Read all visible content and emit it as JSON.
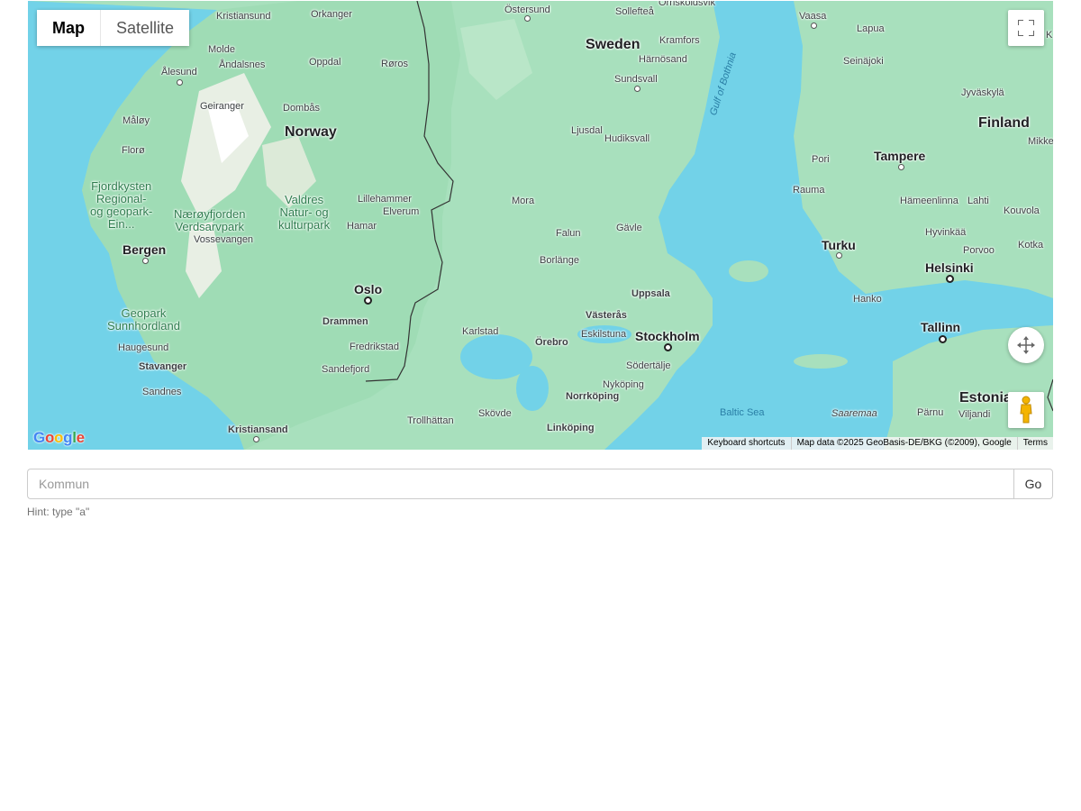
{
  "map": {
    "type_controls": {
      "map_label": "Map",
      "satellite_label": "Satellite",
      "active": "Map"
    },
    "icons": [
      "fullscreen-icon",
      "camera-control-icon",
      "pegman-icon"
    ],
    "footer": {
      "shortcuts": "Keyboard shortcuts",
      "attribution": "Map data ©2025 GeoBasis-DE/BKG (©2009), Google",
      "terms": "Terms"
    },
    "logo": "Google",
    "labels": {
      "sweden": "Sweden",
      "norway": "Norway",
      "finland": "Finland",
      "estonia": "Estonia",
      "oslo": "Oslo",
      "stockholm": "Stockholm",
      "helsinki": "Helsinki",
      "tallinn": "Tallinn",
      "bergen": "Bergen",
      "turku": "Turku",
      "tampere": "Tampere",
      "kristiansund": "Kristiansund",
      "orkanger": "Orkanger",
      "ostersund": "Östersund",
      "solleftea": "Sollefteå",
      "ornskoldsvik": "Örnsköldsvik",
      "vaasa": "Vaasa",
      "lapua": "Lapua",
      "molde": "Molde",
      "andalsnes": "Åndalsnes",
      "oppdal": "Oppdal",
      "roros": "Røros",
      "kramfors": "Kramfors",
      "harnosand": "Härnösand",
      "seinajoki": "Seinäjoki",
      "alesund": "Ålesund",
      "sundsvall": "Sundsvall",
      "jyvaskyla": "Jyväskylä",
      "geiranger": "Geiranger",
      "dombas": "Dombås",
      "maloy": "Måløy",
      "ljusdal": "Ljusdal",
      "hudiksvall": "Hudiksvall",
      "gulf_of_bothnia": "Gulf of Bothnia",
      "mikkeli": "Mikke",
      "floro": "Florø",
      "pori": "Pori",
      "rauma": "Rauma",
      "fjordkysten": "Fjordkysten\nRegional-\nog geopark-\nEin...",
      "naeroyfjorden": "Nærøyfjorden\nVerdsarvpark",
      "valdres": "Valdres\nNatur- og\nkulturpark",
      "lillehammer": "Lillehammer",
      "elverum": "Elverum",
      "hamar": "Hamar",
      "mora": "Mora",
      "hameenlinna": "Hämeenlinna",
      "lahti": "Lahti",
      "kouvola": "Kouvola",
      "vossevangen": "Vossevangen",
      "falun": "Falun",
      "gavle": "Gävle",
      "borlange": "Borlänge",
      "hyvinkaa": "Hyvinkää",
      "porvoo": "Porvoo",
      "kotka": "Kotka",
      "uppsala": "Uppsala",
      "hanko": "Hanko",
      "geopark": "Geopark\nSunnhordland",
      "drammen": "Drammen",
      "vasteras": "Västerås",
      "haugesund": "Haugesund",
      "fredrikstad": "Fredrikstad",
      "karlstad": "Karlstad",
      "eskilstuna": "Eskilstuna",
      "orebro": "Örebro",
      "stavanger": "Stavanger",
      "sandefjord": "Sandefjord",
      "sodertalje": "Södertälje",
      "sandnes": "Sandnes",
      "nykoping": "Nyköping",
      "norrkoping": "Norrköping",
      "baltic_sea": "Baltic Sea",
      "saaremaa": "Saaremaa",
      "parnu": "Pärnu",
      "viljandi": "Viljandi",
      "trollhattan": "Trollhättan",
      "skovde": "Skövde",
      "linkoping": "Linköping",
      "kristiansand": "Kristiansand",
      "k": "K"
    }
  },
  "search": {
    "placeholder": "Kommun",
    "value": "",
    "go_label": "Go",
    "hint": "Hint: type \"a\""
  }
}
